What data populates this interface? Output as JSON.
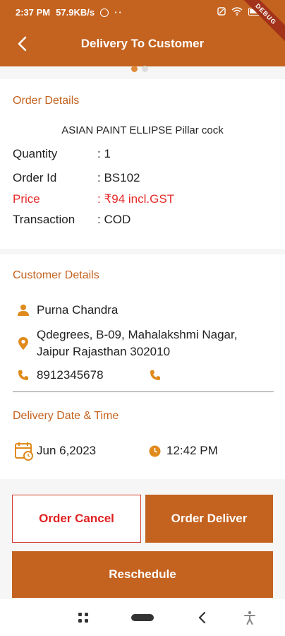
{
  "status_bar": {
    "time": "2:37 PM",
    "speed": "57.9KB/s",
    "dots": "··",
    "debug_label": "DEBUG"
  },
  "app_bar": {
    "title": "Delivery To Customer",
    "back_icon": "chevron-left-icon"
  },
  "order_details": {
    "section_title": "Order Details",
    "product_name": "ASIAN PAINT  ELLIPSE Pillar cock",
    "rows": [
      {
        "label": "Quantity",
        "value": ": 1"
      },
      {
        "label": "Order Id",
        "value": ": BS102"
      },
      {
        "label": "Price",
        "value": ": ₹94 incl.GST"
      },
      {
        "label": "Transaction",
        "value": ": COD"
      }
    ]
  },
  "customer_details": {
    "section_title": "Customer Details",
    "name": "Purna Chandra",
    "address_line1": "Qdegrees, B-09,   Mahalakshmi Nagar,",
    "address_line2": "Jaipur  Rajasthan  302010",
    "phone": "8912345678"
  },
  "delivery": {
    "section_title": "Delivery Date & Time",
    "date": "Jun 6,2023",
    "time": "12:42 PM"
  },
  "actions": {
    "cancel_label": "Order Cancel",
    "deliver_label": "Order Deliver",
    "reschedule_label": "Reschedule"
  },
  "colors": {
    "primary": "#c4621f",
    "accent_red": "#e52a2a",
    "background": "#f6f6f6"
  }
}
